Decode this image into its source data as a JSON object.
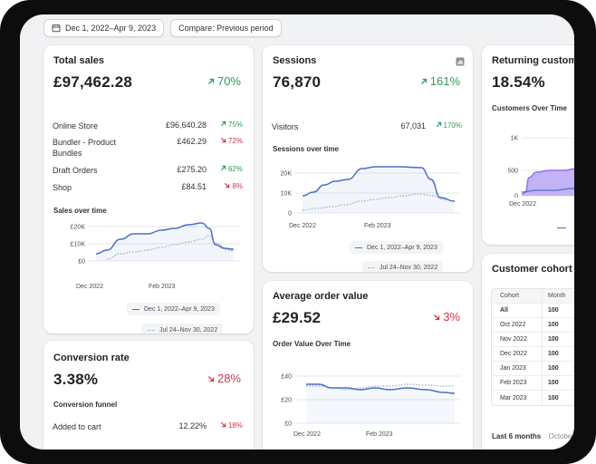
{
  "toolbar": {
    "date_range": "Dec 1, 2022–Apr 9, 2023",
    "compare": "Compare: Previous period"
  },
  "colors": {
    "accent_line": "#4b6fc4",
    "compare_line": "#9aa8cc",
    "up": "#2e9a5c",
    "down": "#d2344a",
    "purple_area": "#c9b8f5"
  },
  "total_sales": {
    "title": "Total sales",
    "value": "£97,462.28",
    "delta": "70%",
    "delta_dir": "up",
    "breakdown": [
      {
        "label": "Online Store",
        "amount": "£96,640.28",
        "change": "75%",
        "dir": "up"
      },
      {
        "label": "Bundler - Product Bundles",
        "amount": "£462.29",
        "change": "72%",
        "dir": "down"
      },
      {
        "label": "Draft Orders",
        "amount": "£275.20",
        "change": "62%",
        "dir": "up"
      },
      {
        "label": "Shop",
        "amount": "£84.51",
        "change": "8%",
        "dir": "down"
      }
    ],
    "chart_title": "Sales over time",
    "y_ticks": [
      "£20K",
      "£10K",
      "£0"
    ],
    "x_ticks": [
      "Dec 2022",
      "Feb 2023"
    ],
    "legend_current": "Dec 1, 2022–Apr 9, 2023",
    "legend_previous": "Jul 24–Nov 30, 2022"
  },
  "sessions": {
    "title": "Sessions",
    "value": "76,870",
    "delta": "161%",
    "delta_dir": "up",
    "row_label": "Visitors",
    "row_value": "67,031",
    "row_change": "170%",
    "chart_title": "Sessions over time",
    "y_ticks": [
      "20K",
      "10K",
      "0"
    ],
    "x_ticks": [
      "Dec 2022",
      "Feb 2023"
    ],
    "legend_current": "Dec 1, 2022–Apr 9, 2023",
    "legend_previous": "Jul 24–Nov 30, 2022"
  },
  "returning": {
    "title": "Returning customer rate",
    "value": "18.54%",
    "chart_title": "Customers Over Time",
    "y_ticks": [
      "1K",
      "500",
      "0"
    ],
    "x_ticks": [
      "Dec 2022"
    ]
  },
  "aov": {
    "title": "Average order value",
    "value": "£29.52",
    "delta": "3%",
    "delta_dir": "down",
    "chart_title": "Order Value Over Time",
    "y_ticks": [
      "£40",
      "£20",
      "£0"
    ],
    "x_ticks": [
      "Dec 2022",
      "Feb 2023"
    ]
  },
  "conversion": {
    "title": "Conversion rate",
    "value": "3.38%",
    "delta": "28%",
    "delta_dir": "down",
    "funnel_title": "Conversion funnel",
    "row_label": "Added to cart",
    "row_value": "12.22%",
    "row_change": "18%"
  },
  "cohort": {
    "title": "Customer cohort analysis",
    "headers": [
      "Cohort",
      "Month"
    ],
    "rows": [
      {
        "label": "All",
        "val": "100"
      },
      {
        "label": "Oct 2022",
        "val": "100"
      },
      {
        "label": "Nov 2022",
        "val": "100"
      },
      {
        "label": "Dec 2022",
        "val": "100"
      },
      {
        "label": "Jan 2023",
        "val": "100"
      },
      {
        "label": "Feb 2023",
        "val": "100"
      },
      {
        "label": "Mar 2023",
        "val": "100"
      }
    ],
    "footer": "Last 6 months",
    "footer_extra": "October"
  }
}
